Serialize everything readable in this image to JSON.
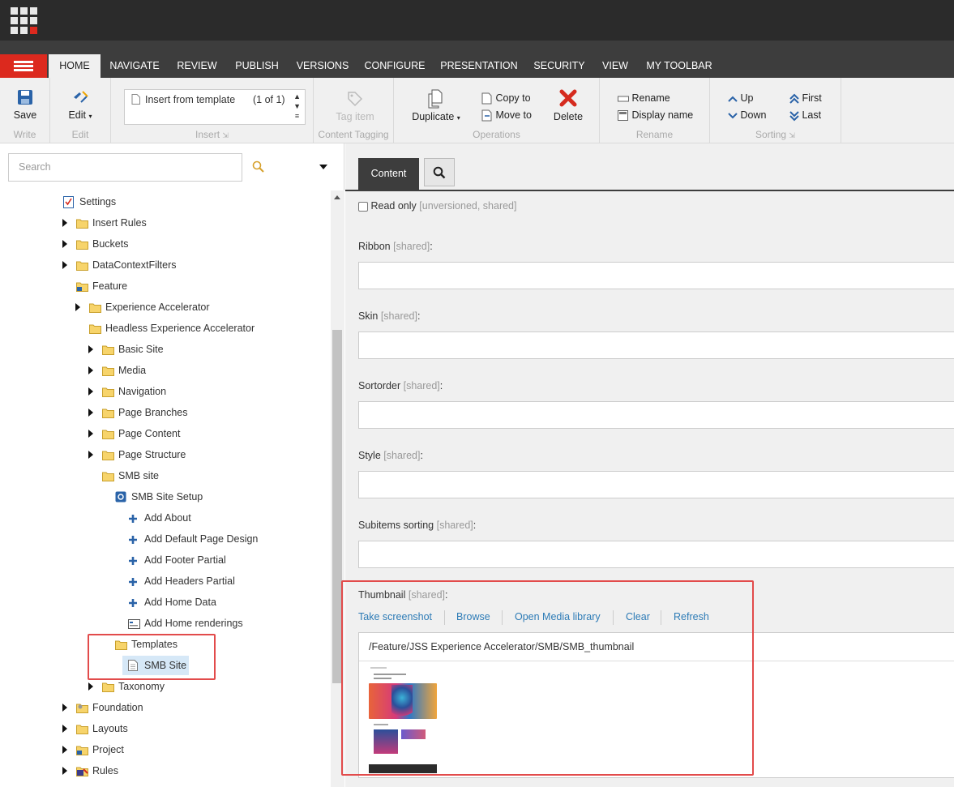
{
  "tabs": [
    "HOME",
    "NAVIGATE",
    "REVIEW",
    "PUBLISH",
    "VERSIONS",
    "CONFIGURE",
    "PRESENTATION",
    "SECURITY",
    "VIEW",
    "MY TOOLBAR"
  ],
  "ribbon": {
    "write": {
      "save": "Save",
      "label": "Write"
    },
    "edit": {
      "edit": "Edit",
      "label": "Edit"
    },
    "insert": {
      "item": "Insert from template",
      "count": "(1 of 1)",
      "label": "Insert"
    },
    "tagging": {
      "tag": "Tag item",
      "label": "Content Tagging"
    },
    "operations": {
      "duplicate": "Duplicate",
      "copy": "Copy to",
      "move": "Move to",
      "delete": "Delete",
      "label": "Operations"
    },
    "rename": {
      "rename": "Rename",
      "display": "Display name",
      "label": "Rename"
    },
    "sorting": {
      "up": "Up",
      "down": "Down",
      "first": "First",
      "last": "Last",
      "label": "Sorting"
    }
  },
  "search": {
    "placeholder": "Search"
  },
  "tree": [
    {
      "label": "Settings",
      "indent": 0,
      "arrow": "d",
      "icon": "settings"
    },
    {
      "label": "Insert Rules",
      "indent": 1,
      "arrow": "r",
      "icon": "folder"
    },
    {
      "label": "Buckets",
      "indent": 1,
      "arrow": "r",
      "icon": "folder"
    },
    {
      "label": "DataContextFilters",
      "indent": 1,
      "arrow": "r",
      "icon": "folder"
    },
    {
      "label": "Feature",
      "indent": 1,
      "arrow": "d",
      "icon": "folder-blue"
    },
    {
      "label": "Experience Accelerator",
      "indent": 2,
      "arrow": "r",
      "icon": "folder"
    },
    {
      "label": "Headless Experience Accelerator",
      "indent": 2,
      "arrow": "d",
      "icon": "folder"
    },
    {
      "label": "Basic Site",
      "indent": 3,
      "arrow": "r",
      "icon": "folder"
    },
    {
      "label": "Media",
      "indent": 3,
      "arrow": "r",
      "icon": "folder"
    },
    {
      "label": "Navigation",
      "indent": 3,
      "arrow": "r",
      "icon": "folder"
    },
    {
      "label": "Page Branches",
      "indent": 3,
      "arrow": "r",
      "icon": "folder"
    },
    {
      "label": "Page Content",
      "indent": 3,
      "arrow": "r",
      "icon": "folder"
    },
    {
      "label": "Page Structure",
      "indent": 3,
      "arrow": "r",
      "icon": "folder"
    },
    {
      "label": "SMB site",
      "indent": 3,
      "arrow": "d",
      "icon": "folder"
    },
    {
      "label": "SMB Site Setup",
      "indent": 4,
      "arrow": "d",
      "icon": "setup"
    },
    {
      "label": "Add About",
      "indent": 5,
      "arrow": "",
      "icon": "plus"
    },
    {
      "label": "Add Default Page Design",
      "indent": 5,
      "arrow": "",
      "icon": "plus"
    },
    {
      "label": "Add Footer Partial",
      "indent": 5,
      "arrow": "",
      "icon": "plus"
    },
    {
      "label": "Add Headers Partial",
      "indent": 5,
      "arrow": "",
      "icon": "plus"
    },
    {
      "label": "Add Home Data",
      "indent": 5,
      "arrow": "",
      "icon": "plus"
    },
    {
      "label": "Add Home renderings",
      "indent": 5,
      "arrow": "",
      "icon": "render"
    },
    {
      "label": "Templates",
      "indent": 4,
      "arrow": "d",
      "icon": "folder"
    },
    {
      "label": "SMB Site",
      "indent": 5,
      "arrow": "",
      "icon": "doc",
      "selected": true
    },
    {
      "label": "Taxonomy",
      "indent": 3,
      "arrow": "r",
      "icon": "folder"
    },
    {
      "label": "Foundation",
      "indent": 1,
      "arrow": "r",
      "icon": "folder-gear"
    },
    {
      "label": "Layouts",
      "indent": 1,
      "arrow": "r",
      "icon": "folder"
    },
    {
      "label": "Project",
      "indent": 1,
      "arrow": "r",
      "icon": "folder-blue"
    },
    {
      "label": "Rules",
      "indent": 1,
      "arrow": "r",
      "icon": "rules"
    }
  ],
  "editor": {
    "tab_content": "Content",
    "readonly_label": "Read only",
    "readonly_meta": "[unversioned, shared]",
    "fields": [
      {
        "name": "Ribbon",
        "meta": "[shared]"
      },
      {
        "name": "Skin",
        "meta": "[shared]"
      },
      {
        "name": "Sortorder",
        "meta": "[shared]"
      },
      {
        "name": "Style",
        "meta": "[shared]"
      },
      {
        "name": "Subitems sorting",
        "meta": "[shared]"
      }
    ],
    "thumbnail": {
      "name": "Thumbnail",
      "meta": "[shared]",
      "links": [
        "Take screenshot",
        "Browse",
        "Open Media library",
        "Clear",
        "Refresh"
      ],
      "path": "/Feature/JSS Experience Accelerator/SMB/SMB_thumbnail"
    }
  },
  "colors": {
    "accent": "#dc291e",
    "link": "#2d7bb6",
    "highlight": "#e24b4b"
  }
}
